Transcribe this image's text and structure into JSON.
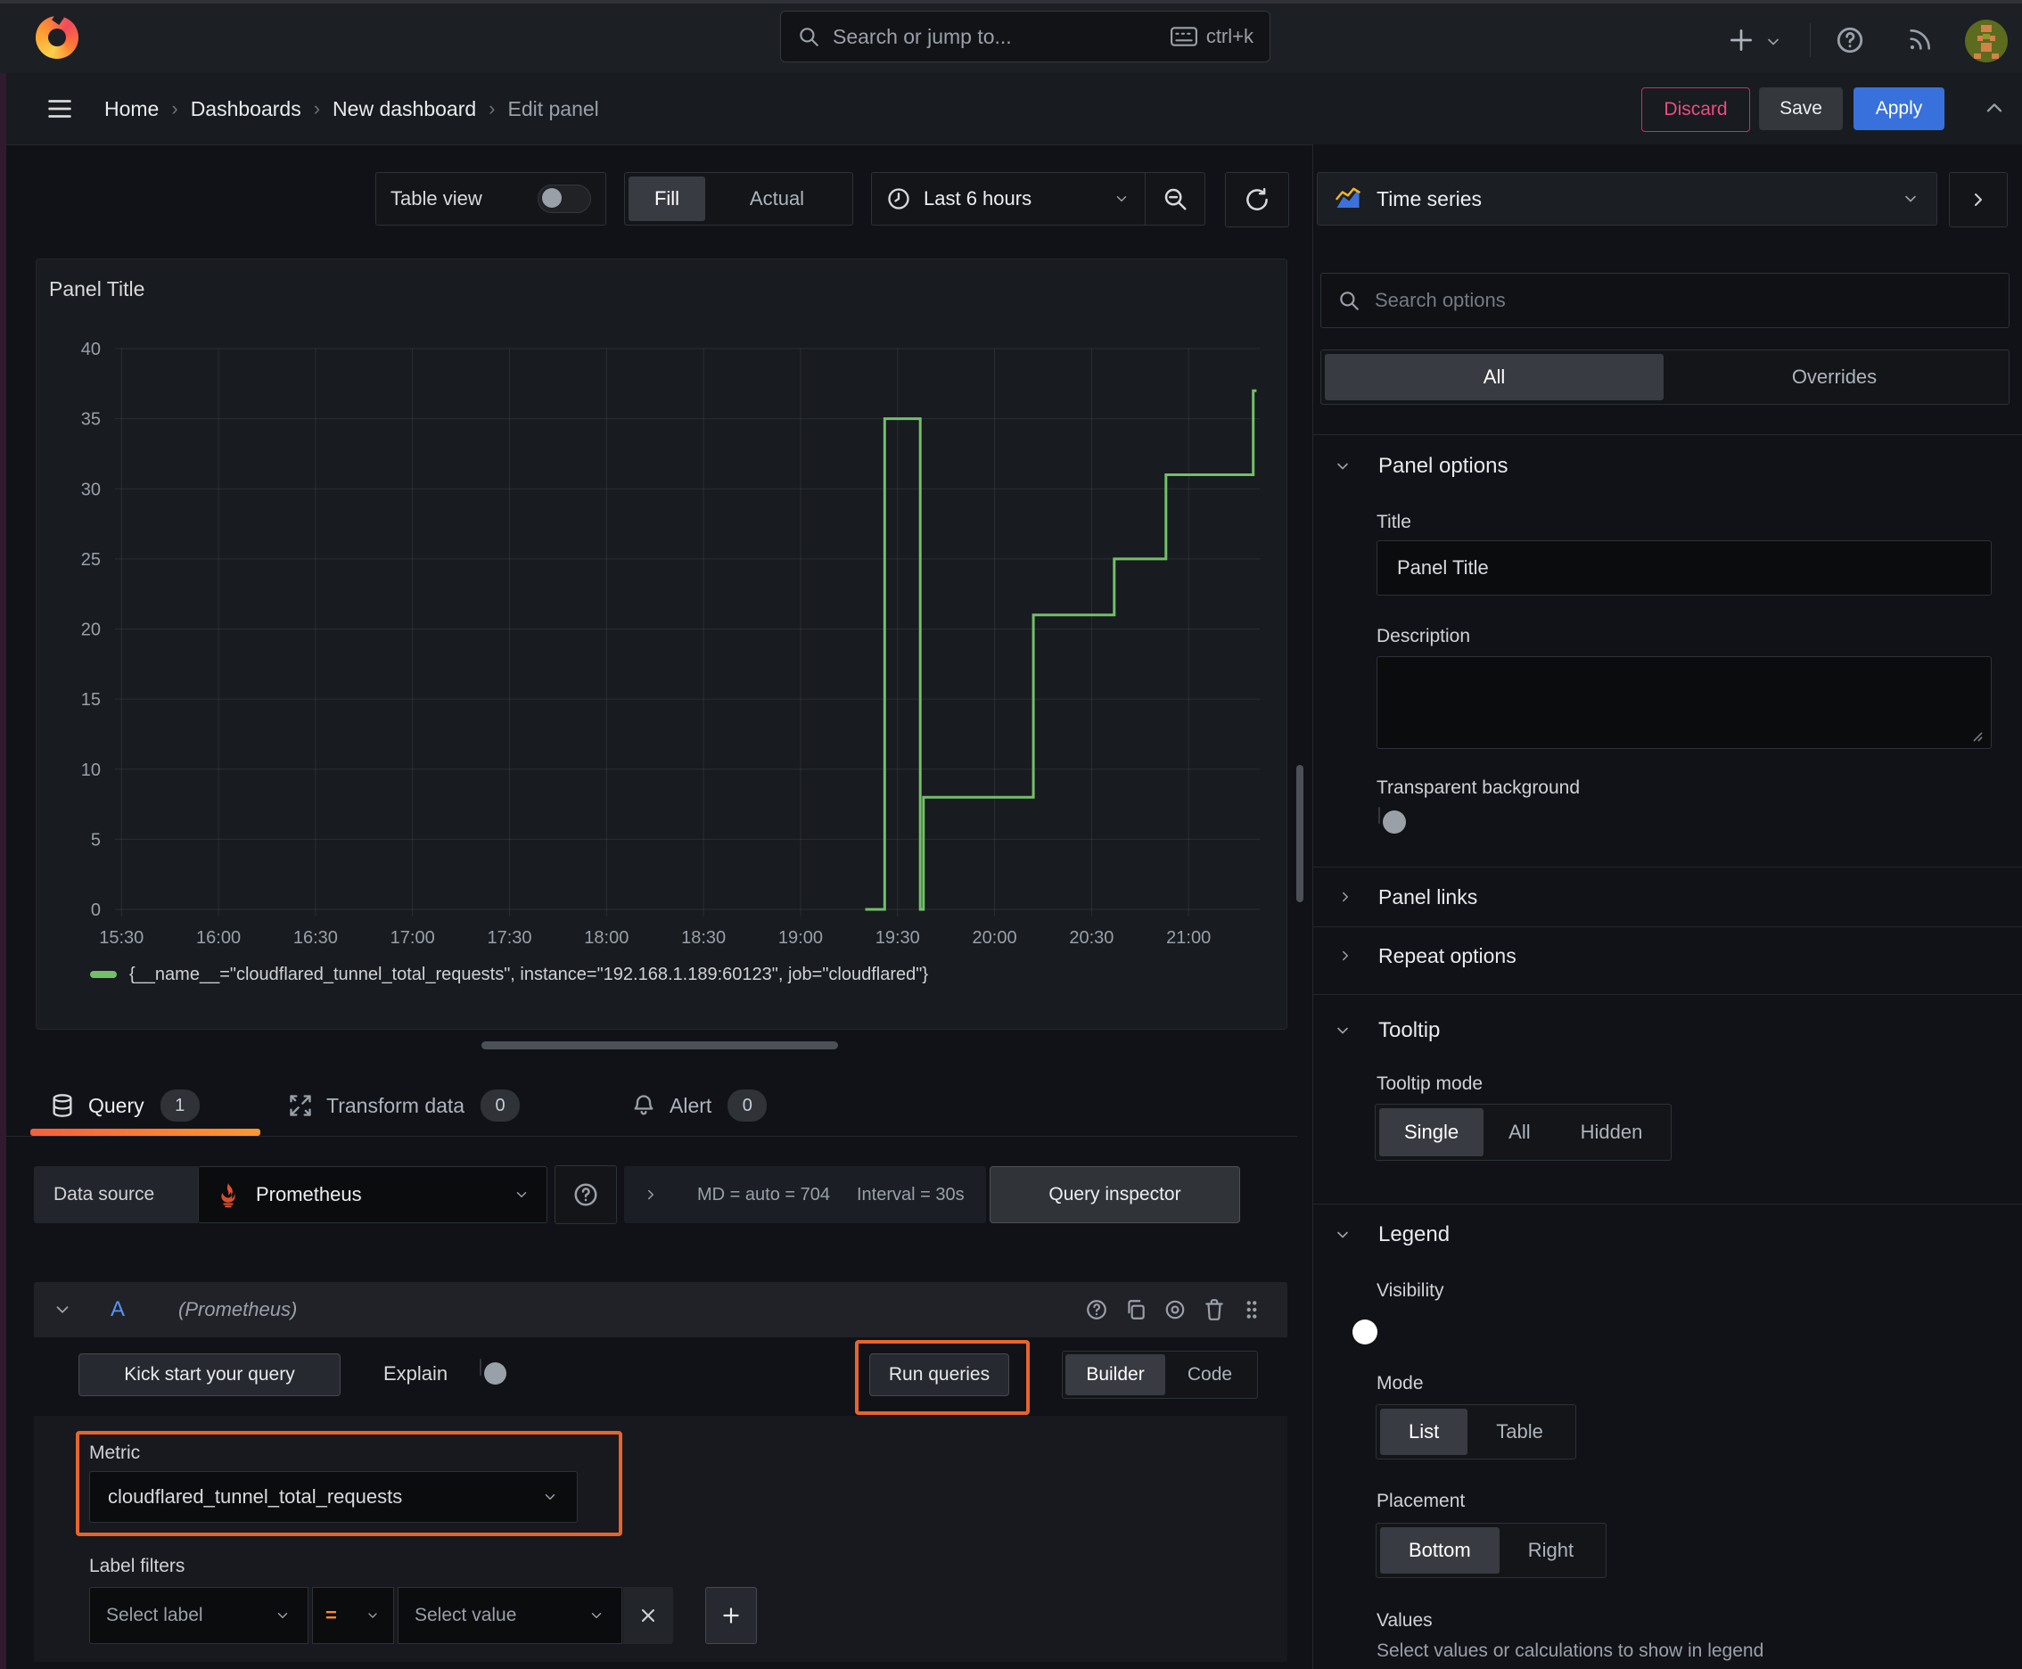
{
  "topbar": {
    "search_placeholder": "Search or jump to...",
    "shortcut": "ctrl+k"
  },
  "breadcrumb": {
    "items": [
      "Home",
      "Dashboards",
      "New dashboard",
      "Edit panel"
    ]
  },
  "actions": {
    "discard": "Discard",
    "save": "Save",
    "apply": "Apply"
  },
  "toolbar": {
    "table_view": "Table view",
    "fill": "Fill",
    "actual": "Actual",
    "time_range": "Last 6 hours"
  },
  "viz_picker": {
    "type": "Time series"
  },
  "panel": {
    "title": "Panel Title"
  },
  "chart_data": {
    "type": "line",
    "title": "Panel Title",
    "xlabel": "",
    "ylabel": "",
    "ylim": [
      0,
      40
    ],
    "y_ticks": [
      0,
      5,
      10,
      15,
      20,
      25,
      30,
      35,
      40
    ],
    "x_range_minutes": [
      928,
      1282
    ],
    "x_ticks": [
      {
        "label": "15:30",
        "min": 930
      },
      {
        "label": "16:00",
        "min": 960
      },
      {
        "label": "16:30",
        "min": 990
      },
      {
        "label": "17:00",
        "min": 1020
      },
      {
        "label": "17:30",
        "min": 1050
      },
      {
        "label": "18:00",
        "min": 1080
      },
      {
        "label": "18:30",
        "min": 1110
      },
      {
        "label": "19:00",
        "min": 1140
      },
      {
        "label": "19:30",
        "min": 1170
      },
      {
        "label": "20:00",
        "min": 1200
      },
      {
        "label": "20:30",
        "min": 1230
      },
      {
        "label": "21:00",
        "min": 1260
      }
    ],
    "grid": true,
    "legend_position": "bottom",
    "series": [
      {
        "name": "{__name__=\"cloudflared_tunnel_total_requests\", instance=\"192.168.1.189:60123\", job=\"cloudflared\"}",
        "color": "#73bf69",
        "step": "after",
        "points_min": [
          [
            1160,
            0
          ],
          [
            1166,
            35
          ],
          [
            1177,
            0
          ],
          [
            1178,
            8
          ],
          [
            1212,
            21
          ],
          [
            1237,
            25
          ],
          [
            1253,
            31
          ],
          [
            1280,
            37
          ],
          [
            1281,
            37
          ]
        ],
        "points_time": [
          [
            "19:20",
            0
          ],
          [
            "19:26",
            35
          ],
          [
            "19:37",
            0
          ],
          [
            "19:38",
            8
          ],
          [
            "20:12",
            21
          ],
          [
            "20:37",
            25
          ],
          [
            "20:53",
            31
          ],
          [
            "21:20",
            37
          ]
        ]
      }
    ]
  },
  "tabs": [
    {
      "label": "Query",
      "count": "1"
    },
    {
      "label": "Transform data",
      "count": "0"
    },
    {
      "label": "Alert",
      "count": "0"
    }
  ],
  "query": {
    "datasource_label": "Data source",
    "datasource": "Prometheus",
    "summary_md": "MD = auto = 704",
    "summary_interval": "Interval = 30s",
    "inspector": "Query inspector",
    "ref_id": "A",
    "ref_note": "(Prometheus)",
    "kick_start": "Kick start your query",
    "explain": "Explain",
    "run": "Run queries",
    "builder": "Builder",
    "code": "Code",
    "metric_label": "Metric",
    "metric_value": "cloudflared_tunnel_total_requests",
    "label_filters": "Label filters",
    "select_label": "Select label",
    "operator": "=",
    "select_value": "Select value"
  },
  "options": {
    "search_placeholder": "Search options",
    "tab_all": "All",
    "tab_overrides": "Overrides",
    "panel_options": "Panel options",
    "title_label": "Title",
    "title_value": "Panel Title",
    "description_label": "Description",
    "transparent": "Transparent background",
    "panel_links": "Panel links",
    "repeat_options": "Repeat options",
    "tooltip": "Tooltip",
    "tooltip_mode": "Tooltip mode",
    "tooltip_modes": [
      "Single",
      "All",
      "Hidden"
    ],
    "legend": "Legend",
    "visibility": "Visibility",
    "mode": "Mode",
    "mode_options": [
      "List",
      "Table"
    ],
    "placement": "Placement",
    "placement_options": [
      "Bottom",
      "Right"
    ],
    "values": "Values",
    "values_hint": "Select values or calculations to show in legend"
  },
  "colors": {
    "series_green": "#73bf69",
    "annotation_orange": "#e8642c",
    "apply_blue": "#3871dc",
    "discard_red": "#e0226e",
    "refid_blue": "#5794f2",
    "operator_orange": "#ff8833",
    "tab_underline_from": "#f55f3e",
    "tab_underline_to": "#ff9830"
  }
}
